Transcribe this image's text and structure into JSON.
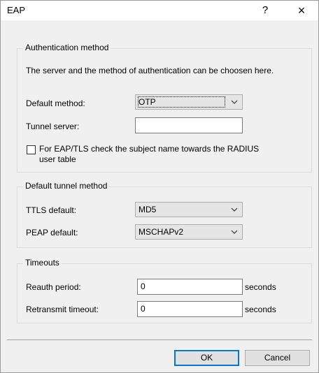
{
  "window": {
    "title": "EAP",
    "help_label": "?",
    "close_label": "×"
  },
  "auth": {
    "legend": "Authentication method",
    "description": "The server and the method of authentication can be choosen here.",
    "default_method_label": "Default method:",
    "default_method_value": "OTP",
    "tunnel_server_label": "Tunnel server:",
    "tunnel_server_value": "",
    "check_subject_checked": false,
    "check_subject_label_line1": "For EAP/TLS check the subject name towards the RADIUS",
    "check_subject_label_line2": "user table"
  },
  "tunnel": {
    "legend": "Default tunnel method",
    "ttls_label": "TTLS default:",
    "ttls_value": "MD5",
    "peap_label": "PEAP default:",
    "peap_value": "MSCHAPv2"
  },
  "timeouts": {
    "legend": "Timeouts",
    "reauth_label": "Reauth period:",
    "reauth_value": "0",
    "reauth_unit": "seconds",
    "retransmit_label": "Retransmit timeout:",
    "retransmit_value": "0",
    "retransmit_unit": "seconds"
  },
  "buttons": {
    "ok_label": "OK",
    "cancel_label": "Cancel"
  },
  "icons": {
    "chevron": "chevron-down-icon",
    "close": "close-icon",
    "help": "help-icon"
  }
}
